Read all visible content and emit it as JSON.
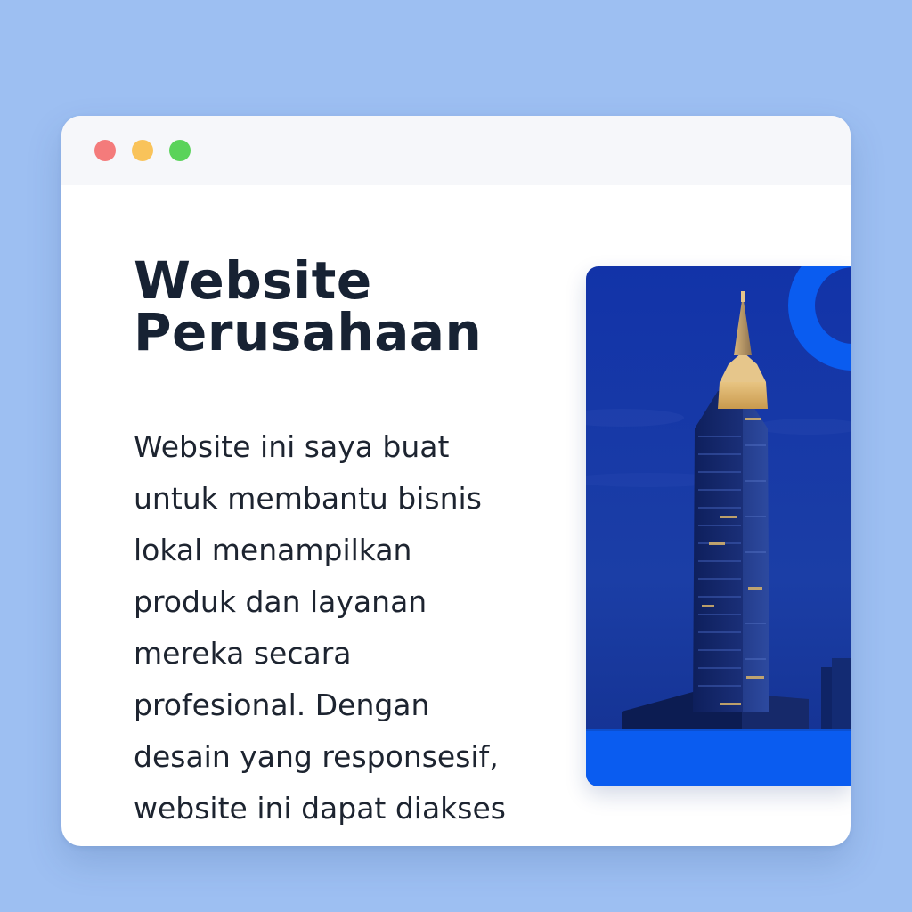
{
  "window": {
    "controls": [
      "close",
      "minimize",
      "maximize"
    ],
    "control_colors": [
      "#f47b7b",
      "#f9c35a",
      "#5ad35a"
    ]
  },
  "content": {
    "title_lines": [
      "Website",
      "Perusahaan"
    ],
    "description_lines": [
      "Website ini saya buat",
      "untuk membantu bisnis",
      "lokal menampilkan",
      "produk dan layanan",
      "mereka secara",
      "profesional. Dengan",
      "desain yang responsesif,",
      "website ini dapat diakses"
    ]
  },
  "hero_image": {
    "subject": "skyscraper at dusk",
    "accent_color": "#0a5cf0"
  },
  "colors": {
    "background": "#9dbff2",
    "heading": "#172233",
    "text": "#1d2430",
    "accent": "#0a5cf0"
  }
}
